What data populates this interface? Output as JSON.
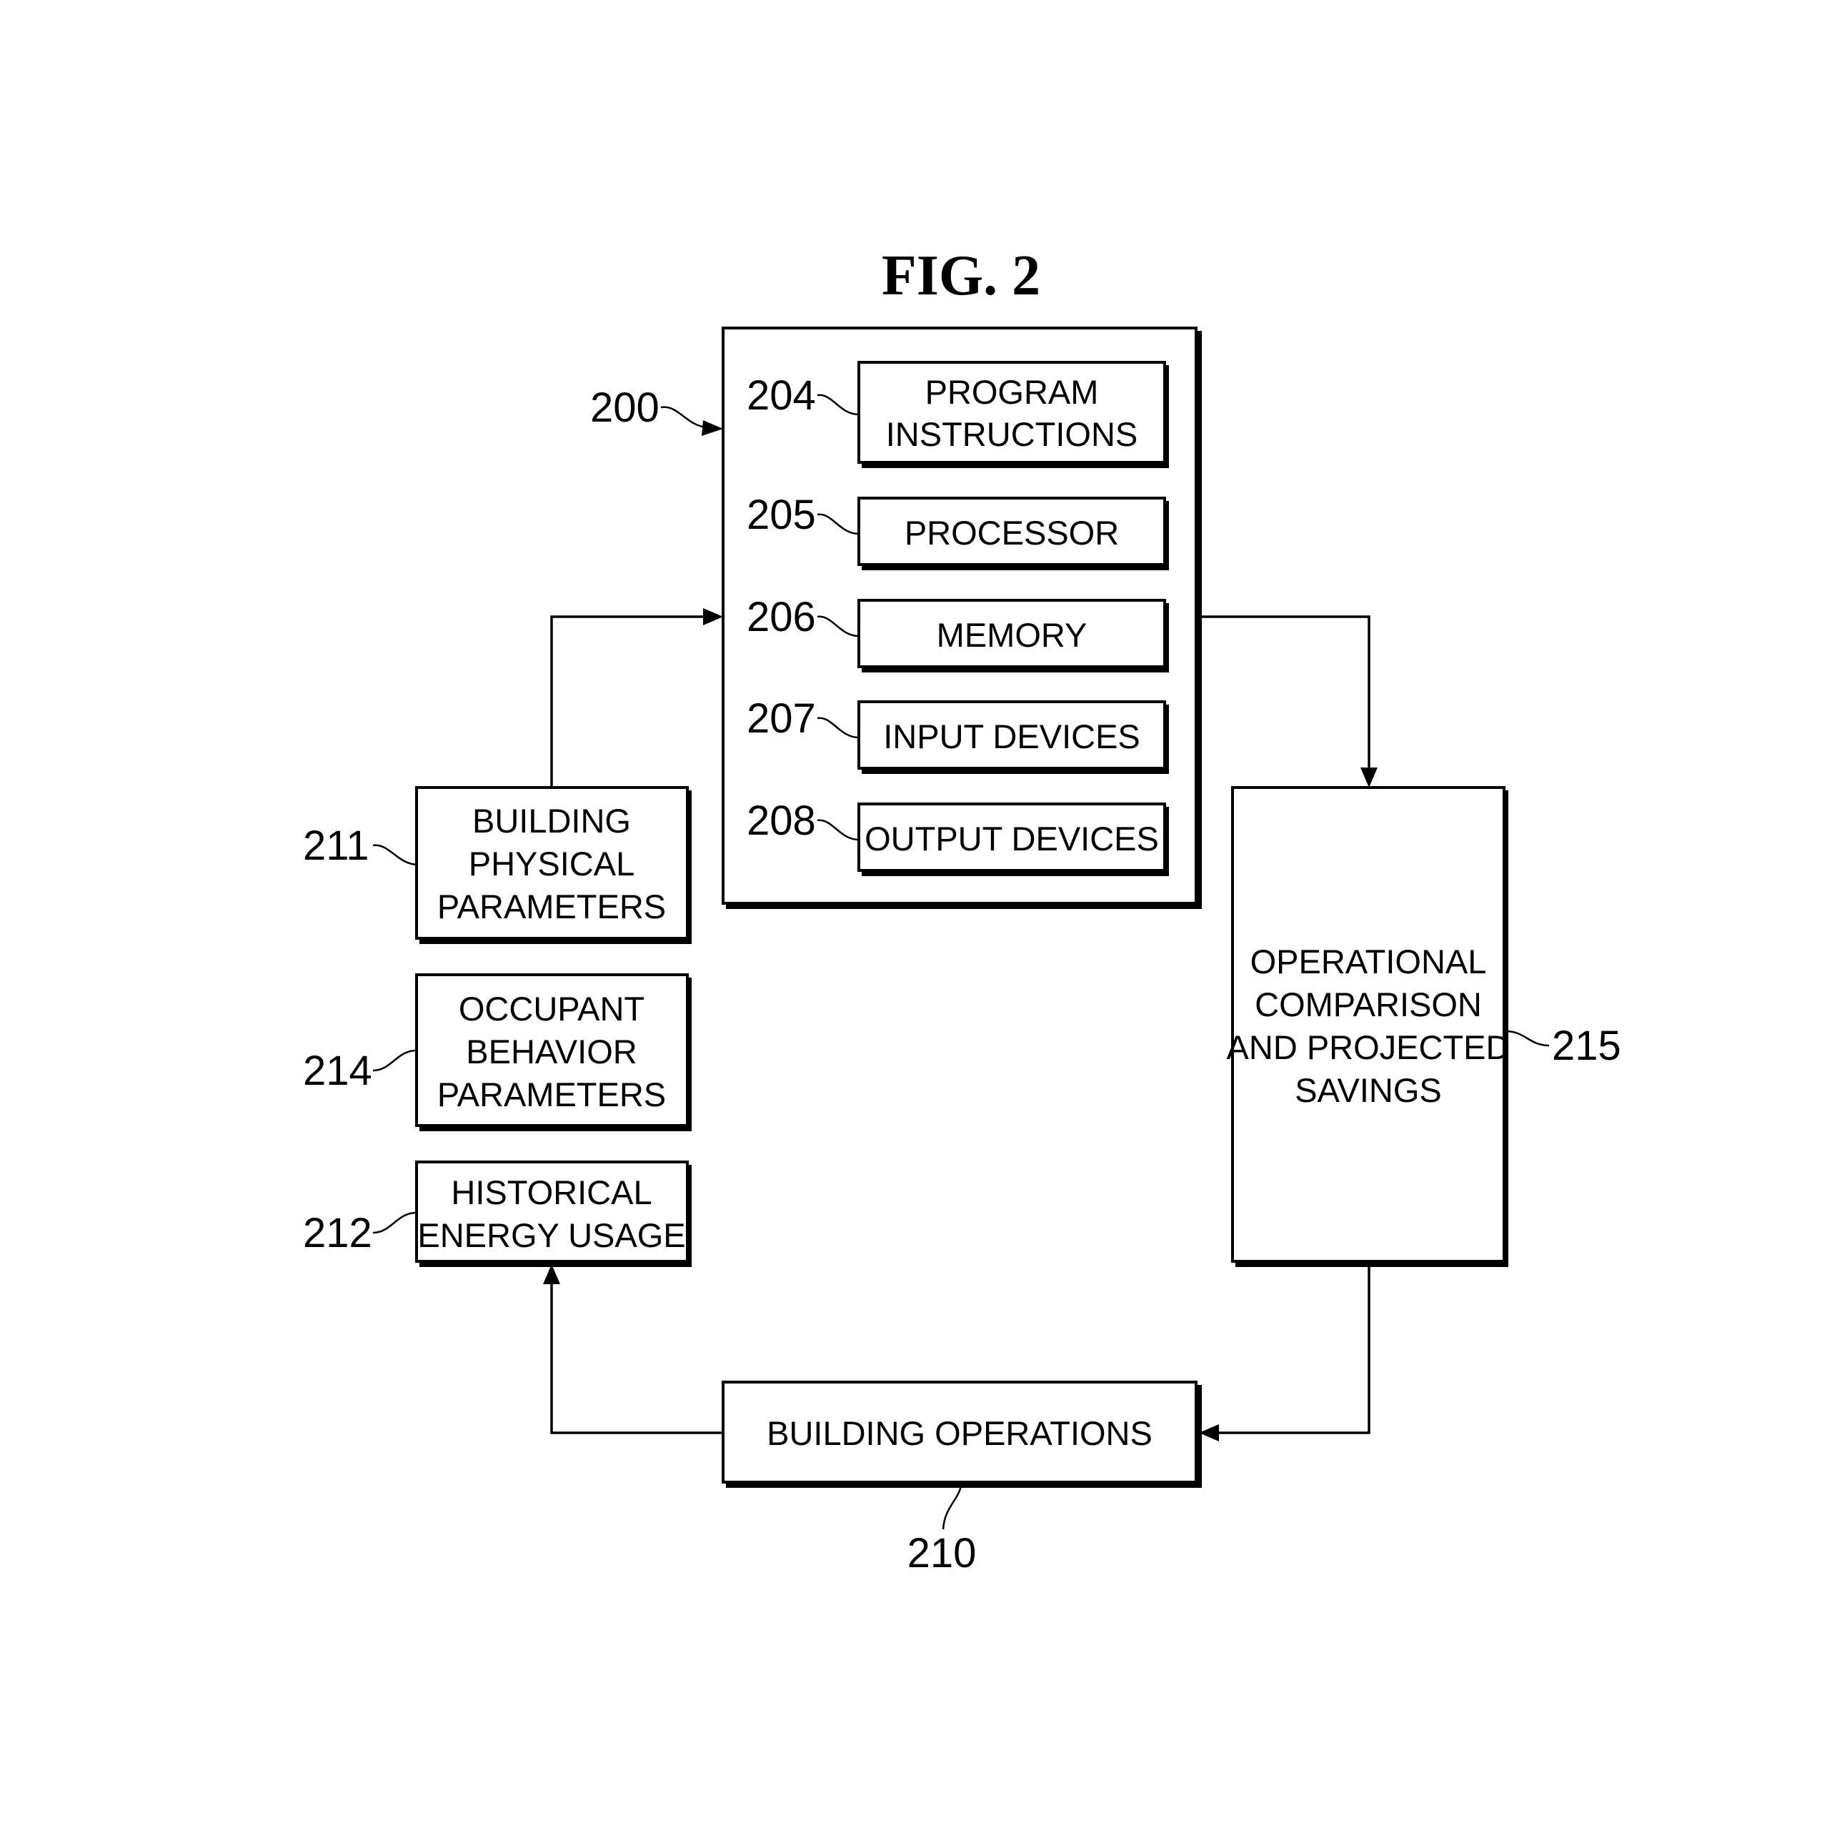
{
  "figure": {
    "title": "FIG. 2"
  },
  "system": {
    "ref": "200",
    "components": [
      {
        "ref": "204",
        "lines": [
          "PROGRAM",
          "INSTRUCTIONS"
        ]
      },
      {
        "ref": "205",
        "lines": [
          "PROCESSOR"
        ]
      },
      {
        "ref": "206",
        "lines": [
          "MEMORY"
        ]
      },
      {
        "ref": "207",
        "lines": [
          "INPUT DEVICES"
        ]
      },
      {
        "ref": "208",
        "lines": [
          "OUTPUT DEVICES"
        ]
      }
    ]
  },
  "inputs": [
    {
      "ref": "211",
      "lines": [
        "BUILDING",
        "PHYSICAL",
        "PARAMETERS"
      ]
    },
    {
      "ref": "214",
      "lines": [
        "OCCUPANT",
        "BEHAVIOR",
        "PARAMETERS"
      ]
    },
    {
      "ref": "212",
      "lines": [
        "HISTORICAL",
        "ENERGY USAGE"
      ]
    }
  ],
  "comparison": {
    "ref": "215",
    "lines": [
      "OPERATIONAL",
      "COMPARISON",
      "AND PROJECTED",
      "SAVINGS"
    ]
  },
  "operations": {
    "ref": "210",
    "lines": [
      "BUILDING OPERATIONS"
    ]
  }
}
